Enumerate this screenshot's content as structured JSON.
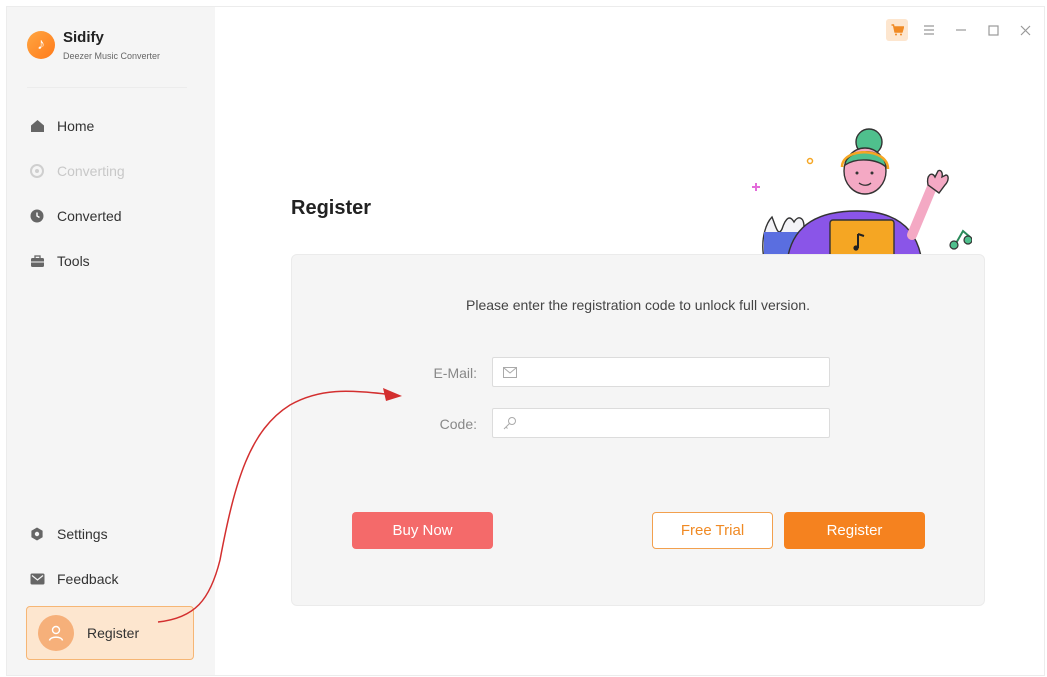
{
  "app": {
    "name": "Sidify",
    "subtitle": "Deezer Music Converter"
  },
  "sidebar": {
    "items": [
      {
        "label": "Home",
        "icon": "home-icon",
        "enabled": true
      },
      {
        "label": "Converting",
        "icon": "converting-icon",
        "enabled": false
      },
      {
        "label": "Converted",
        "icon": "clock-icon",
        "enabled": true
      },
      {
        "label": "Tools",
        "icon": "toolbox-icon",
        "enabled": true
      }
    ],
    "bottom_items": [
      {
        "label": "Settings",
        "icon": "gear-icon"
      },
      {
        "label": "Feedback",
        "icon": "mail-icon"
      }
    ],
    "register_label": "Register"
  },
  "titlebar": {
    "icons": [
      "cart-icon",
      "menu-icon",
      "minimize-icon",
      "maximize-icon",
      "close-icon"
    ]
  },
  "main": {
    "title": "Register",
    "message": "Please enter the registration code to unlock full version.",
    "email_label": "E-Mail:",
    "email_value": "",
    "code_label": "Code:",
    "code_value": "",
    "buy_now_label": "Buy Now",
    "free_trial_label": "Free Trial",
    "register_label": "Register"
  },
  "colors": {
    "accent": "#f5821f",
    "buy_now": "#f46a6a",
    "annotation_arrow": "#d32f2f"
  }
}
